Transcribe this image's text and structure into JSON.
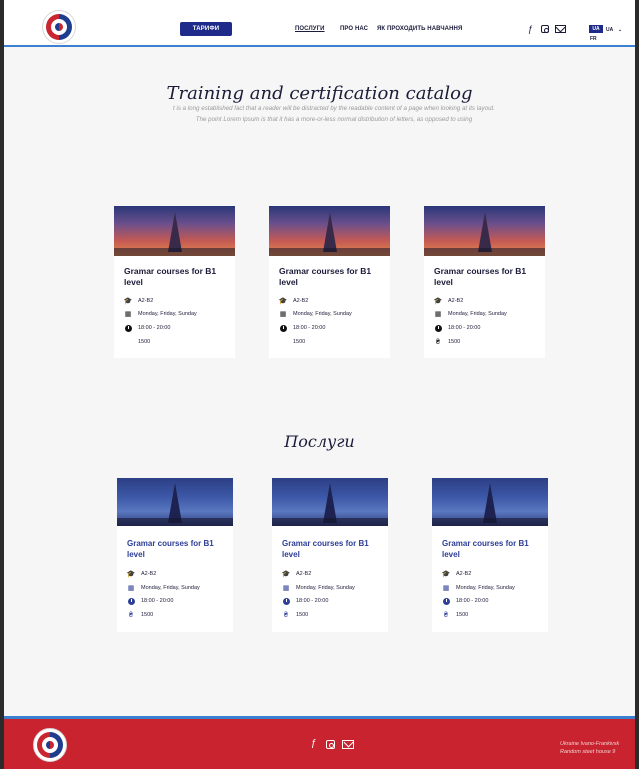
{
  "header": {
    "tariffs_button": "ТАРИФИ",
    "nav": [
      "ПОСЛУГИ",
      "ПРО НАС",
      "ЯК ПРОХОДИТЬ НАВЧАННЯ"
    ],
    "social_icons": [
      "facebook-icon",
      "instagram-icon",
      "mail-icon"
    ],
    "lang_selected": "UA",
    "lang_options": [
      "UA",
      "FR"
    ]
  },
  "catalog": {
    "title": "Training and certification catalog",
    "description": "t is a long established fact that a reader will be distracted by the readable content of a page when looking at its layout. The point Lorem Ipsum is that it has a more-or-less normal distribution of letters, as opposed to using",
    "cards": [
      {
        "title": "Gramar courses for B1 level",
        "level": "A2-B2",
        "days": "Monday, Friday, Sunday",
        "time": "18:00 - 20:00",
        "price": "1500",
        "price_icon": ""
      },
      {
        "title": "Gramar courses for B1 level",
        "level": "A2-B2",
        "days": "Monday, Friday, Sunday",
        "time": "18:00 - 20:00",
        "price": "1500",
        "price_icon": ""
      },
      {
        "title": "Gramar courses for B1 level",
        "level": "A2-B2",
        "days": "Monday, Friday, Sunday",
        "time": "18:00 - 20:00",
        "price": "1500",
        "price_icon": "₴"
      }
    ]
  },
  "services": {
    "title": "Послуги",
    "cards": [
      {
        "title": "Gramar courses for B1 level",
        "level": "A2-B2",
        "days": "Monday, Friday, Sunday",
        "time": "18:00 - 20:00",
        "price": "1500",
        "price_icon": "₴"
      },
      {
        "title": "Gramar courses for B1 level",
        "level": "A2-B2",
        "days": "Monday, Friday, Sunday",
        "time": "18:00 - 20:00",
        "price": "1500",
        "price_icon": "₴"
      },
      {
        "title": "Gramar courses for B1 level",
        "level": "A2-B2",
        "days": "Monday, Friday, Sunday",
        "time": "18:00 - 20:00",
        "price": "1500",
        "price_icon": "₴"
      }
    ]
  },
  "footer": {
    "address_line1": "Ukraine Ivano-Frankivsk",
    "address_line2": "Random steet house 9"
  },
  "colors": {
    "primary": "#1f2b8a",
    "accent_red": "#c8232f",
    "accent_blue": "#3b7fd0"
  }
}
